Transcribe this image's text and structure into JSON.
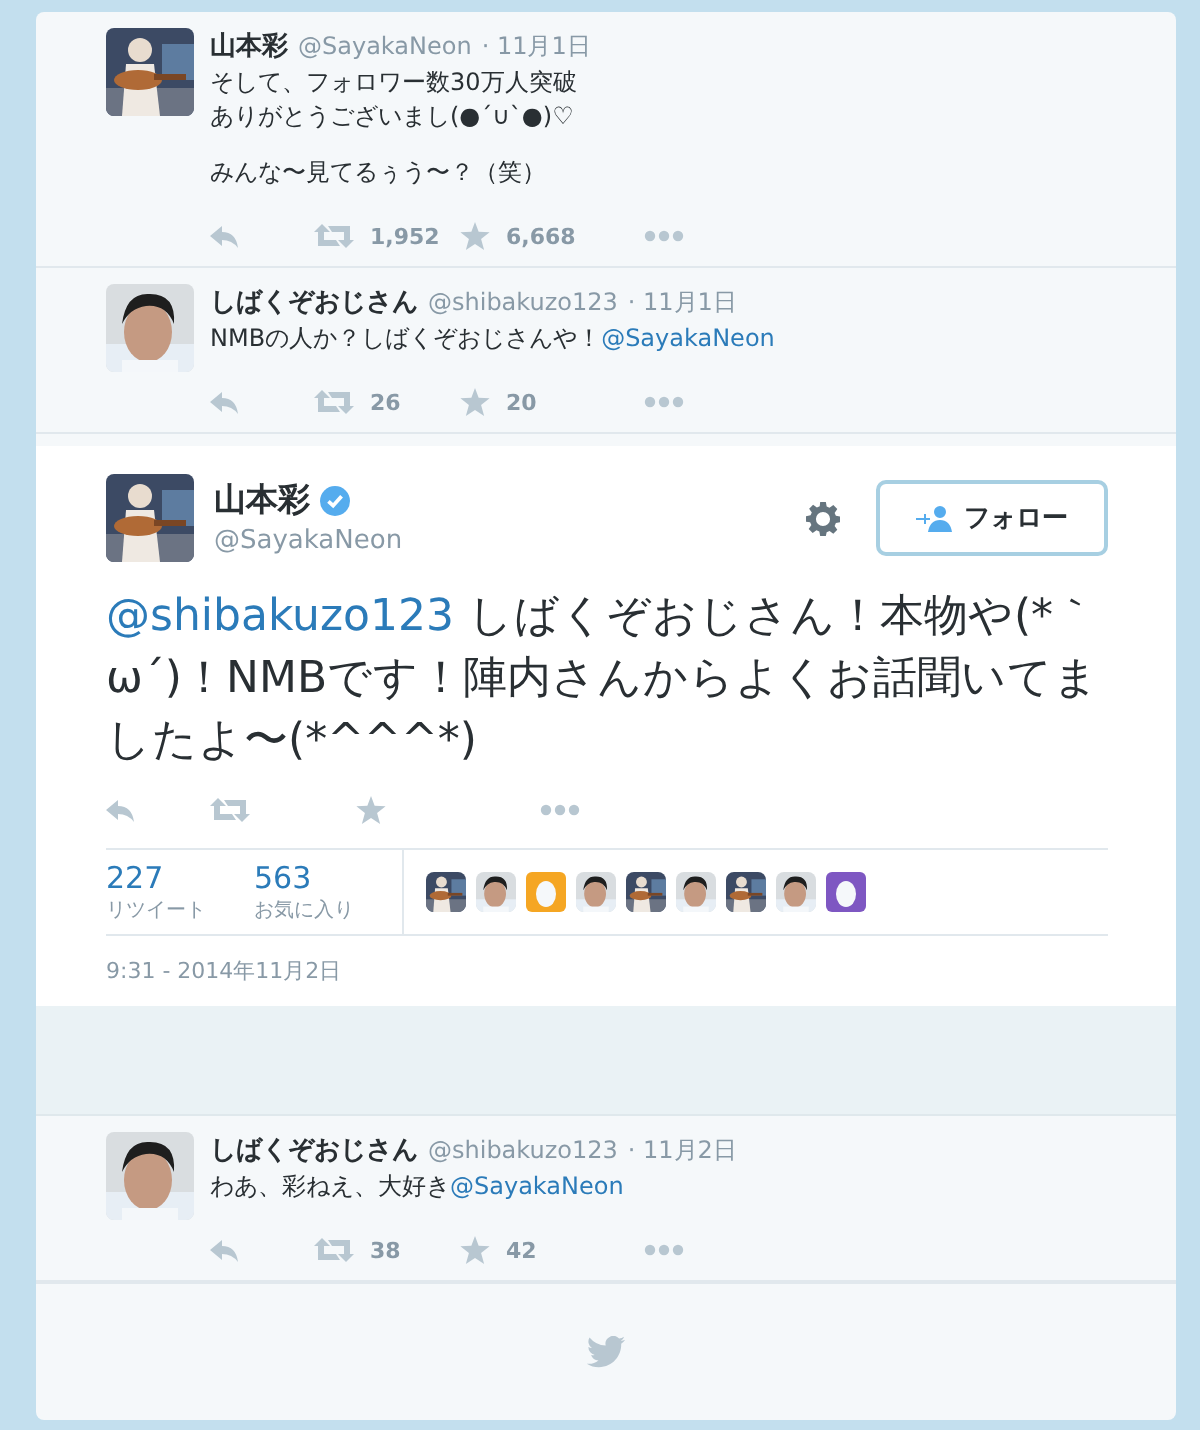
{
  "replies_before": [
    {
      "name": "山本彩",
      "handle": "@SayakaNeon",
      "date": "· 11月1日",
      "paragraphs": [
        [
          [
            {
              "kind": "text",
              "text": "そして、フォロワー数30万人突破"
            }
          ],
          [
            {
              "kind": "text",
              "text": "ありがとうございまし(●´∪`●)♡"
            }
          ]
        ],
        [
          [
            {
              "kind": "text",
              "text": "みんな〜見てるぅう〜？（笑）"
            }
          ]
        ]
      ],
      "retweets": "1,952",
      "favorites": "6,668"
    },
    {
      "name": "しばくぞおじさん",
      "handle": "@shibakuzo123",
      "date": "· 11月1日",
      "paragraphs": [
        [
          [
            {
              "kind": "text",
              "text": "NMBの人か？しばくぞおじさんや！"
            },
            {
              "kind": "mention",
              "text": "@SayakaNeon"
            }
          ]
        ]
      ],
      "retweets": "26",
      "favorites": "20"
    }
  ],
  "main_tweet": {
    "name": "山本彩",
    "verified": true,
    "handle": "@SayakaNeon",
    "follow_label": "フォロー",
    "segments": [
      {
        "kind": "mention",
        "text": "@shibakuzo123"
      },
      {
        "kind": "text",
        "text": " しばくぞおじさん！本物や(*｀ω´)！NMBです！陣内さんからよくお話聞いてましたよ〜(*^^^*)"
      }
    ],
    "stats": [
      {
        "value": "227",
        "label": "リツイート"
      },
      {
        "value": "563",
        "label": "お気に入り"
      }
    ],
    "favoriters": [
      {
        "kind": "picture"
      },
      {
        "kind": "picture"
      },
      {
        "kind": "egg",
        "color": "#f5a623"
      },
      {
        "kind": "picture"
      },
      {
        "kind": "picture"
      },
      {
        "kind": "picture"
      },
      {
        "kind": "picture"
      },
      {
        "kind": "picture"
      },
      {
        "kind": "egg",
        "color": "#7e57c2"
      }
    ],
    "timestamp": "9:31 - 2014年11月2日"
  },
  "replies_after": [
    {
      "name": "しばくぞおじさん",
      "handle": "@shibakuzo123",
      "date": "· 11月2日",
      "paragraphs": [
        [
          [
            {
              "kind": "text",
              "text": "わあ、彩ねえ、大好き"
            },
            {
              "kind": "mention",
              "text": "@SayakaNeon"
            }
          ]
        ]
      ],
      "retweets": "38",
      "favorites": "42"
    }
  ]
}
